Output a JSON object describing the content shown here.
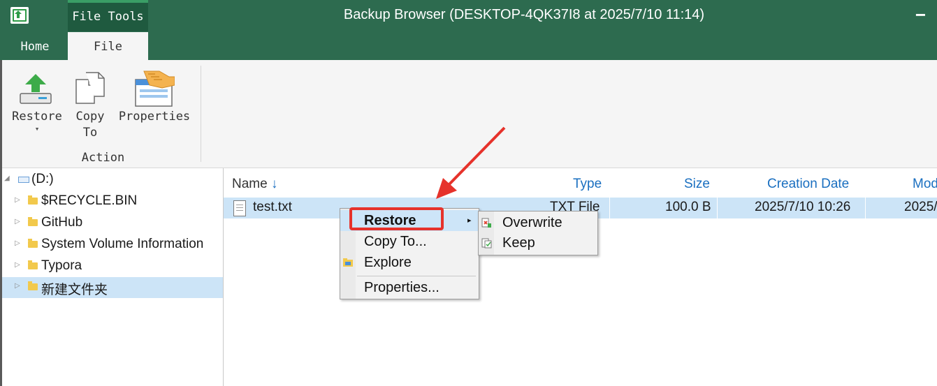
{
  "window": {
    "title": "Backup Browser (DESKTOP-4QK37I8 at 2025/7/10 11:14)",
    "minimize": "−",
    "icon": "restore-app-icon"
  },
  "tabs": {
    "contextual": "File Tools",
    "home": "Home",
    "file": "File"
  },
  "ribbon": {
    "restore_label": "Restore",
    "restore_dropdown": "▾",
    "copy_to_label_1": "Copy",
    "copy_to_label_2": "To",
    "properties_label": "Properties",
    "group_label": "Action"
  },
  "tree": {
    "root": "(D:)",
    "items": [
      {
        "label": "$RECYCLE.BIN"
      },
      {
        "label": "GitHub"
      },
      {
        "label": "System Volume Information"
      },
      {
        "label": "Typora"
      },
      {
        "label": "新建文件夹"
      }
    ]
  },
  "list": {
    "columns": {
      "name": "Name",
      "name_sort": "↓",
      "type": "Type",
      "size": "Size",
      "creation": "Creation Date",
      "modified": "Mod"
    },
    "rows": [
      {
        "name": "test.txt",
        "type": "TXT File",
        "size": "100.0 B",
        "created": "2025/7/10 10:26",
        "modified": "2025/"
      }
    ]
  },
  "context_menu": {
    "restore": "Restore",
    "copy_to": "Copy To...",
    "explore": "Explore",
    "properties": "Properties...",
    "submenu_arrow": "▸"
  },
  "submenu": {
    "overwrite": "Overwrite",
    "keep": "Keep"
  },
  "colors": {
    "titlebar": "#2d6b4f",
    "selection": "#cce4f7",
    "link_header": "#1a6fc0",
    "annotation": "#e6322b"
  }
}
